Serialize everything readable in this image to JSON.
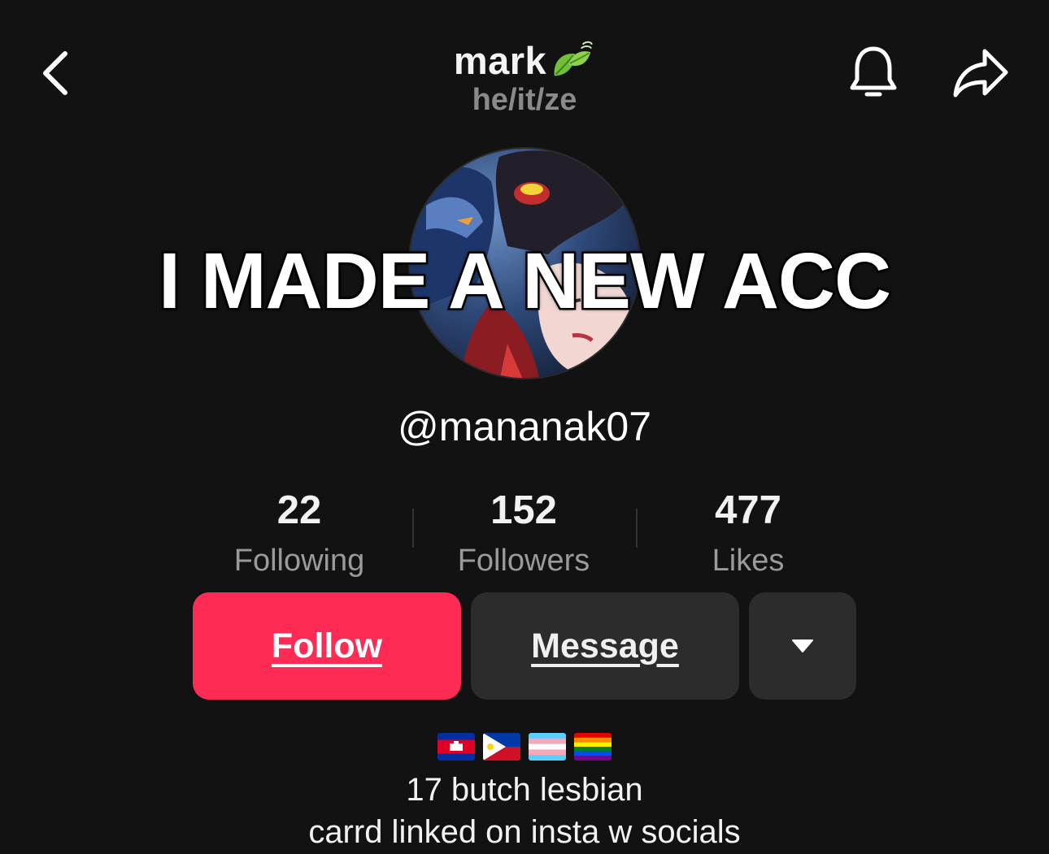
{
  "header": {
    "display_name": "mark",
    "pronouns": "he/it/ze"
  },
  "icons": {
    "back": "chevron-left-icon",
    "bell": "bell-icon",
    "share": "share-arrow-icon",
    "name_emoji": "leaves-icon",
    "more": "caret-down-icon"
  },
  "overlay_text": "I MADE A NEW ACC",
  "profile": {
    "username": "@mananak07"
  },
  "stats": [
    {
      "value": "22",
      "label": "Following"
    },
    {
      "value": "152",
      "label": "Followers"
    },
    {
      "value": "477",
      "label": "Likes"
    }
  ],
  "actions": {
    "follow_label": "Follow",
    "message_label": "Message"
  },
  "bio": {
    "flags": [
      "cambodia-flag",
      "philippines-flag",
      "transgender-flag",
      "rainbow-flag"
    ],
    "line1": "17 butch lesbian",
    "line2": "carrd linked on insta w socials"
  },
  "colors": {
    "background": "#121212",
    "follow_button": "#fe2c55",
    "secondary_button": "#2c2c2c",
    "muted_text": "#8a8a8a"
  }
}
